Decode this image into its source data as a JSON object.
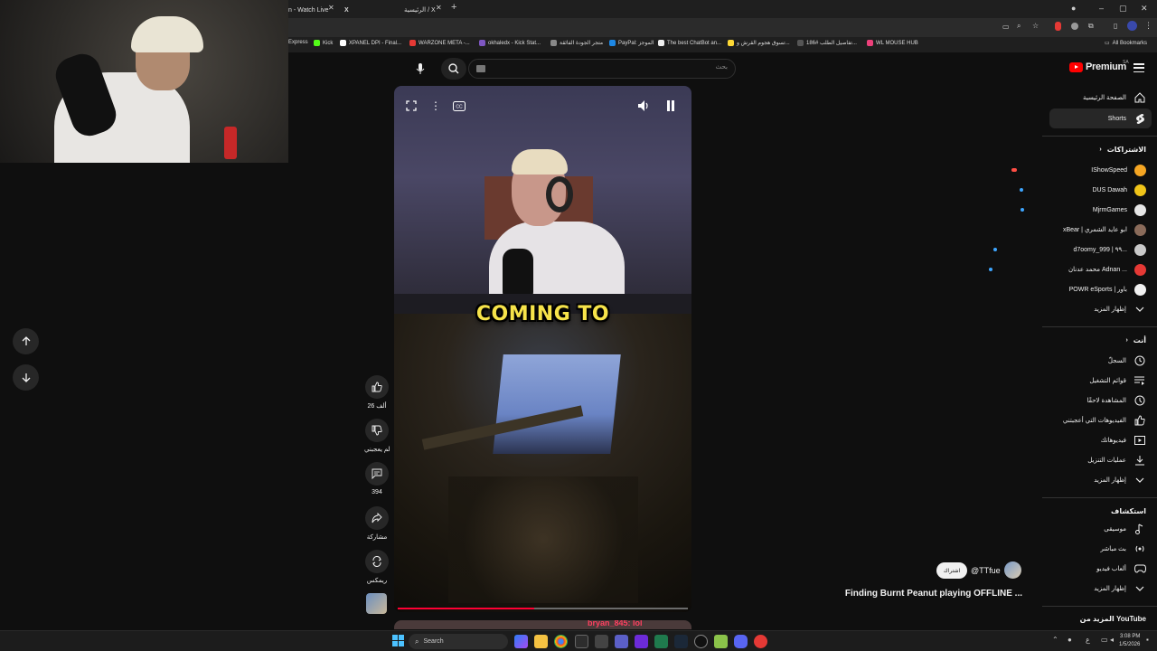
{
  "browser": {
    "tabs": [
      {
        "title": "n - Watch Live"
      },
      {
        "title": "X"
      },
      {
        "title": "الرئيسية / X"
      }
    ],
    "new_tab": "+",
    "bookmarks": [
      "Express",
      "Kick",
      "XPANEL DPI - Final...",
      "WARZONE META -...",
      "okhaledx - Kick Stat...",
      "متجر الجودة الفائقة",
      "PayPal: الموجز",
      "The best ChatBot an...",
      "تسوق هجوم القرش و...",
      "تفاصيل الطلب #186...",
      "WL MOUSE HUB"
    ],
    "all_bookmarks": "All Bookmarks"
  },
  "header": {
    "logo_text": "Premium",
    "region": "SA",
    "search_placeholder": "بحث"
  },
  "sidebar": {
    "main": [
      {
        "label": "الصفحة الرئيسية",
        "icon": "home-icon"
      },
      {
        "label": "Shorts",
        "icon": "shorts-icon"
      }
    ],
    "subscriptions_heading": "الاشتراكات",
    "subscriptions": [
      {
        "label": "IShowSpeed",
        "avatar_color": "#f5a623",
        "indicator": "live"
      },
      {
        "label": "DUS Dawah",
        "avatar_color": "#f0c419",
        "indicator": "dot"
      },
      {
        "label": "MjrmGames",
        "avatar_color": "#e6e6e6",
        "indicator": "dot"
      },
      {
        "label": "xBear | ابو عايد الشمري",
        "avatar_color": "#8a6b5a",
        "indicator": "none"
      },
      {
        "label": "d7oomy_999 | ٩٩...",
        "avatar_color": "#c9c9c9",
        "indicator": "dot"
      },
      {
        "label": "محمد عدنان Adnan ...",
        "avatar_color": "#e53935",
        "indicator": "dot"
      },
      {
        "label": "POWR eSports | باور",
        "avatar_color": "#f1f1f1",
        "indicator": "none"
      }
    ],
    "show_more_1": "إظهار المزيد",
    "you_heading": "أنت",
    "you": [
      {
        "label": "السجلّ",
        "icon": "history-icon"
      },
      {
        "label": "قوائم التشغيل",
        "icon": "playlist-icon"
      },
      {
        "label": "المشاهدة لاحقًا",
        "icon": "clock-icon"
      },
      {
        "label": "الفيديوهات التي أعجبتني",
        "icon": "like-icon"
      },
      {
        "label": "فيديوهاتك",
        "icon": "your-videos-icon"
      },
      {
        "label": "عمليات التنزيل",
        "icon": "download-icon"
      }
    ],
    "show_more_2": "إظهار المزيد",
    "explore_heading": "استكشاف",
    "explore": [
      {
        "label": "موسيقى",
        "icon": "music-icon"
      },
      {
        "label": "بث مباشر",
        "icon": "live-icon"
      },
      {
        "label": "ألعاب فيديو",
        "icon": "gaming-icon"
      }
    ],
    "show_more_3": "إظهار المزيد",
    "more_from_youtube": "المزيد من YouTube"
  },
  "video": {
    "caption": "COMING TO",
    "progress": 0.47,
    "next_preview_text": "bryan_845: lol"
  },
  "actions": {
    "like_count": "26 ألف",
    "dislike_label": "لم يعجبني",
    "comment_count": "394",
    "share_label": "مشاركة",
    "remix_label": "ريمكس"
  },
  "channel": {
    "handle": "@TTfue",
    "subscribe_label": "اشتراك",
    "title": "Finding Burnt Peanut playing OFFLINE ..."
  },
  "taskbar": {
    "search_label": "Search",
    "time": "3:08 PM",
    "date": "1/5/2026",
    "lang": "ع"
  }
}
